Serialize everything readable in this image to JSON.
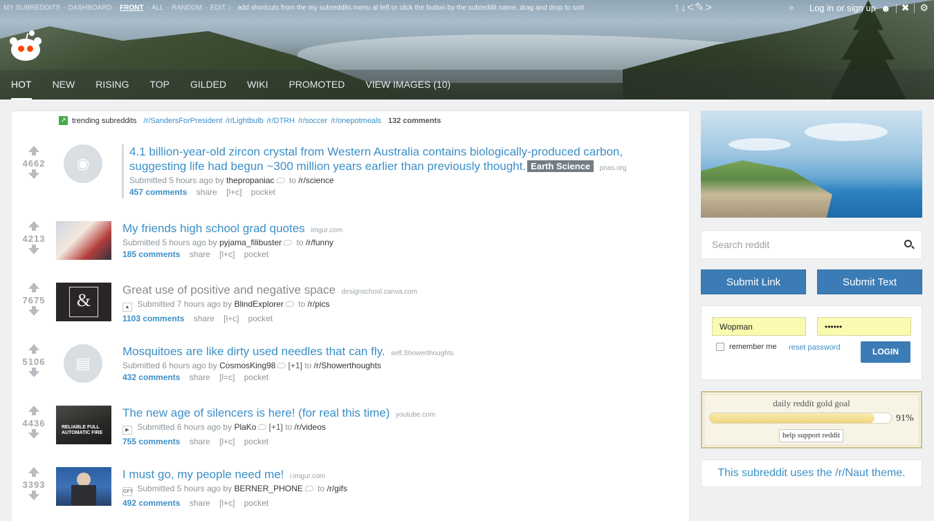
{
  "subreddit_bar": {
    "items": [
      {
        "label": "MY SUBREDDITS"
      },
      {
        "label": "DASHBOARD"
      },
      {
        "label": "FRONT"
      },
      {
        "label": "ALL"
      },
      {
        "label": "RANDOM"
      },
      {
        "label": "EDIT"
      }
    ],
    "hint": "add shortcuts from the my subreddits menu at left or click the button by the subreddit name, drag and drop to sort",
    "sort_icons": "↑↓<✎>",
    "more": "»"
  },
  "user_bar": {
    "login_text": "Log in or sign up",
    "prefs_icon": "wrench-icon",
    "gear_icon": "gear-icon"
  },
  "tabs": [
    {
      "label": "HOT"
    },
    {
      "label": "NEW"
    },
    {
      "label": "RISING"
    },
    {
      "label": "TOP"
    },
    {
      "label": "GILDED"
    },
    {
      "label": "WIKI"
    },
    {
      "label": "PROMOTED"
    },
    {
      "label": "VIEW IMAGES (10)"
    }
  ],
  "trending": {
    "label": "trending subreddits",
    "subreddits": [
      "/r/SandersForPresident",
      "/r/Lightbulb",
      "/r/DTRH",
      "/r/soccer",
      "/r/onepotmeals"
    ],
    "comments": "132 comments"
  },
  "posts": [
    {
      "score": "4662",
      "title": "4.1 billion-year-old zircon crystal from Western Australia contains biologically-produced carbon, suggesting life had begun ~300 million years earlier than previously thought.",
      "flair": "Earth Science",
      "domain": "pnas.org",
      "submitted": "Submitted 5 hours ago by",
      "author": "thepropaniac",
      "to": "to",
      "subreddit": "/r/science",
      "comments": "457 comments",
      "share": "share",
      "rc": "[l+c]",
      "pocket": "pocket"
    },
    {
      "score": "4213",
      "title": "My friends high school grad quotes",
      "domain": "imgur.com",
      "submitted": "Submitted 5 hours ago by",
      "author": "pyjama_filibuster",
      "to": "to",
      "subreddit": "/r/funny",
      "comments": "185 comments",
      "share": "share",
      "rc": "[l+c]",
      "pocket": "pocket"
    },
    {
      "score": "7675",
      "title": "Great use of positive and negative space",
      "domain": "designschool.canva.com",
      "submitted": "Submitted 7 hours ago by",
      "author": "BlindExplorer",
      "to": "to",
      "subreddit": "/r/pics",
      "comments": "1103 comments",
      "share": "share",
      "rc": "[l+c]",
      "pocket": "pocket"
    },
    {
      "score": "5106",
      "title": "Mosquitoes are like dirty used needles that can fly.",
      "domain": "self.Showerthoughts",
      "submitted": "Submitted 6 hours ago by",
      "author": "CosmosKing98",
      "plus": "[+1]",
      "to": "to",
      "subreddit": "/r/Showerthoughts",
      "comments": "432 comments",
      "share": "share",
      "rc": "[l=c]",
      "pocket": "pocket"
    },
    {
      "score": "4436",
      "title": "The new age of silencers is here! (for real this time)",
      "domain": "youtube.com",
      "submitted": "Submitted 6 hours ago by",
      "author": "PlaKo",
      "plus": "[+1]",
      "to": "to",
      "subreddit": "/r/videos",
      "comments": "755 comments",
      "share": "share",
      "rc": "[l+c]",
      "pocket": "pocket",
      "thumb_text": "RELIABLE FULL AUTOMATIC FIRE"
    },
    {
      "score": "3393",
      "title": "I must go, my people need me!",
      "domain": "i.imgur.com",
      "submitted": "Submitted 5 hours ago by",
      "author": "BERNER_PHONE",
      "to": "to",
      "subreddit": "/r/gifs",
      "comments": "492 comments",
      "share": "share",
      "rc": "[l+c]",
      "pocket": "pocket",
      "expando": "GFY"
    }
  ],
  "sidebar": {
    "search_placeholder": "Search reddit",
    "submit_link": "Submit Link",
    "submit_text": "Submit Text",
    "username": "Wopman",
    "password": "••••••",
    "remember_me": "remember me",
    "reset_password": "reset password",
    "login": "LOGIN",
    "gold_title": "daily reddit gold goal",
    "gold_progress": 0.91,
    "gold_percent": "91%",
    "gold_help": "help support reddit",
    "theme_note": "This subreddit uses the /r/Naut theme."
  },
  "colors": {
    "link": "#3b8fc7",
    "button": "#3c7cb6",
    "flair": "#717d85"
  }
}
